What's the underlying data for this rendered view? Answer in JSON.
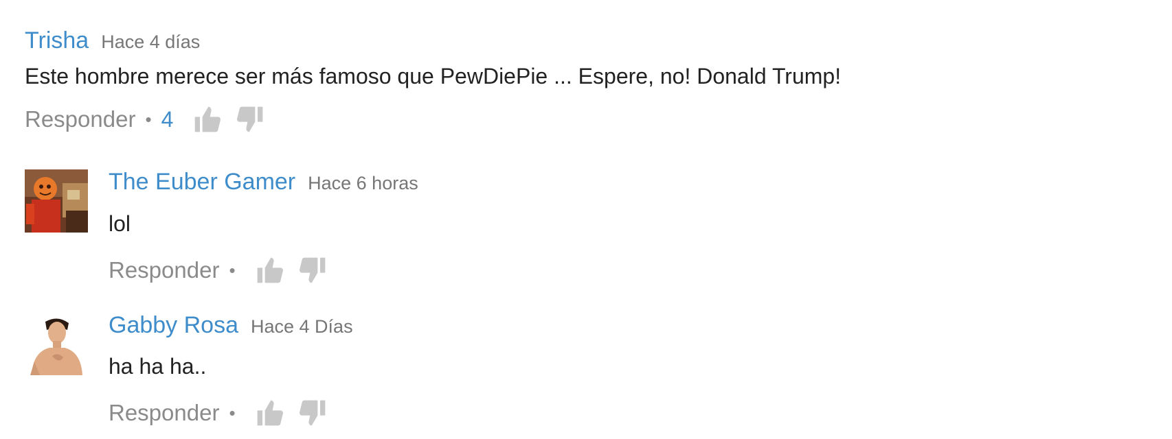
{
  "comments": [
    {
      "author": "Trisha",
      "time": "Hace 4 días",
      "text": "Este hombre merece ser más famoso que PewDiePie ... Espere, no! Donald Trump!",
      "reply_label": "Responder",
      "separator": "•",
      "like_count": "4",
      "has_avatar": false
    },
    {
      "author": "The Euber Gamer",
      "time": "Hace 6 horas",
      "text": "lol",
      "reply_label": "Responder",
      "separator": "•",
      "has_avatar": true,
      "avatar_icon": "orange-character-avatar"
    },
    {
      "author": "Gabby Rosa",
      "time": "Hace 4 Días",
      "text": "ha ha ha..",
      "reply_label": "Responder",
      "separator": "•",
      "has_avatar": true,
      "avatar_icon": "person-photo-avatar"
    }
  ],
  "colors": {
    "author": "#3f8ccb",
    "time": "#767676",
    "body": "#222222",
    "action": "#8a8a8a",
    "icon": "#c8c8c8"
  },
  "icons": {
    "like": "thumbs-up-icon",
    "dislike": "thumbs-down-icon"
  }
}
